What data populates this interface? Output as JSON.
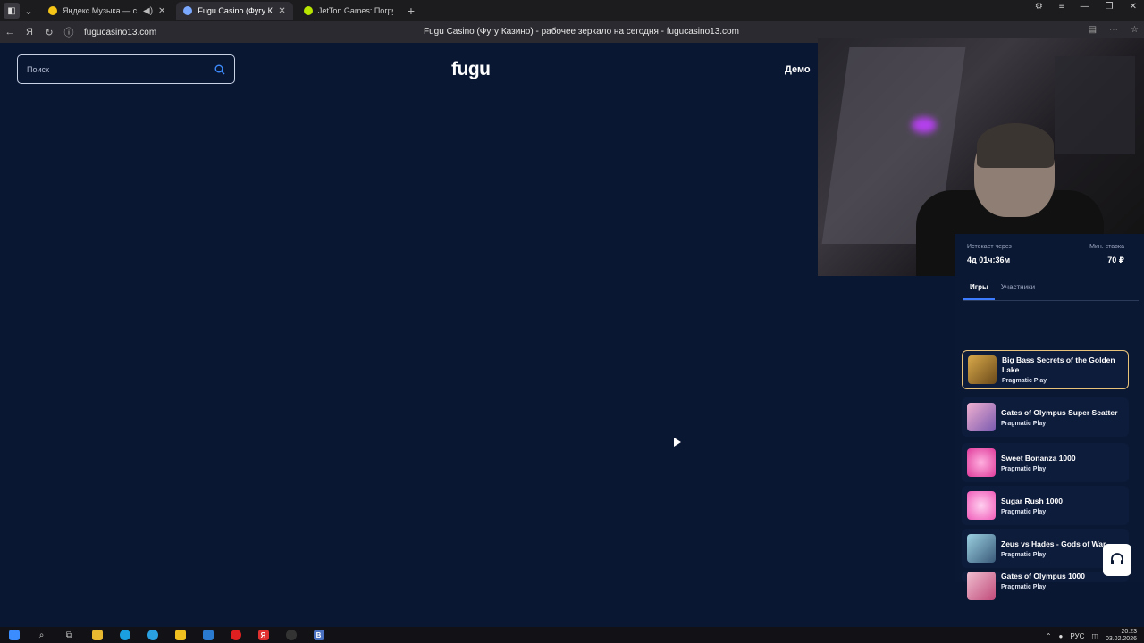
{
  "browser": {
    "tabs": [
      {
        "title": "Яндекс Музыка — с",
        "favicon_color": "#f5c518",
        "active": false
      },
      {
        "title": "Fugu Casino (Фугу Ка",
        "favicon_color": "#7aa8ff",
        "active": true
      },
      {
        "title": "JetTon Games: Погружен",
        "favicon_color": "#b8e600",
        "active": false
      }
    ],
    "url": "fugucasino13.com",
    "page_title": "Fugu Casino (Фугу Казино) - рабочее зеркало на сегодня - fugucasino13.com"
  },
  "header": {
    "search_placeholder": "Поиск",
    "logo": "fugu",
    "demo_label": "Демо"
  },
  "tournament": {
    "expires_label": "Истекает через",
    "expires_value": "4д 01ч:36м",
    "min_bet_label": "Мин. ставка",
    "min_bet_value": "70 ₽",
    "tabs": [
      "Игры",
      "Участники"
    ],
    "games": [
      {
        "name": "Big Bass Secrets of the Golden Lake",
        "provider": "Pragmatic Play",
        "thumb_color": "#b08a3a",
        "selected": true
      },
      {
        "name": "Gates of Olympus Super Scatter",
        "provider": "Pragmatic Play",
        "thumb_color": "#c06aa0",
        "selected": false
      },
      {
        "name": "Sweet Bonanza 1000",
        "provider": "Pragmatic Play",
        "thumb_color": "#e05ab0",
        "selected": false
      },
      {
        "name": "Sugar Rush 1000",
        "provider": "Pragmatic Play",
        "thumb_color": "#f07ac8",
        "selected": false
      },
      {
        "name": "Zeus vs Hades - Gods of War",
        "provider": "Pragmatic Play",
        "thumb_color": "#6a9ab0",
        "selected": false
      },
      {
        "name": "Gates of Olympus 1000",
        "provider": "Pragmatic Play",
        "thumb_color": "#d0708a",
        "selected": false
      }
    ]
  },
  "taskbar": {
    "lang": "РУС",
    "time": "20:23",
    "date": "03.02.2026"
  }
}
